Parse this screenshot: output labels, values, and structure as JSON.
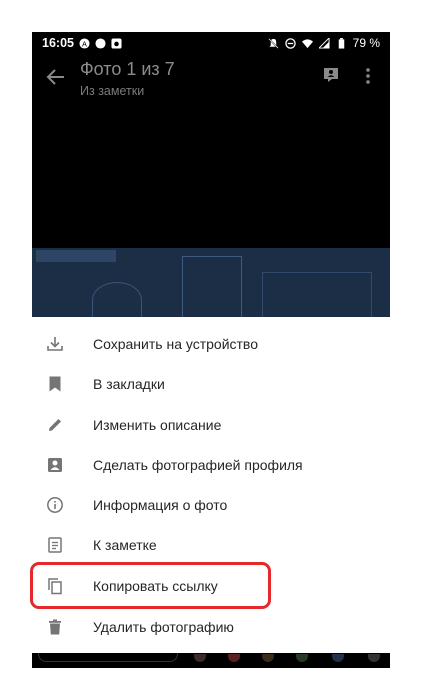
{
  "status_bar": {
    "time": "16:05",
    "battery": "79 %"
  },
  "app_bar": {
    "title": "Фото 1 из 7",
    "subtitle": "Из заметки"
  },
  "menu": {
    "items": [
      {
        "label": "Сохранить на устройство",
        "icon": "download-icon"
      },
      {
        "label": "В закладки",
        "icon": "bookmark-icon"
      },
      {
        "label": "Изменить описание",
        "icon": "pencil-icon"
      },
      {
        "label": "Сделать фотографией профиля",
        "icon": "account-box-icon"
      },
      {
        "label": "Информация о фото",
        "icon": "info-icon"
      },
      {
        "label": "К заметке",
        "icon": "note-icon"
      },
      {
        "label": "Копировать ссылку",
        "icon": "copy-icon"
      },
      {
        "label": "Удалить фотографию",
        "icon": "trash-icon"
      }
    ]
  },
  "colors": {
    "highlight": "#e5282c",
    "icon_gray": "#7a7a7a"
  }
}
